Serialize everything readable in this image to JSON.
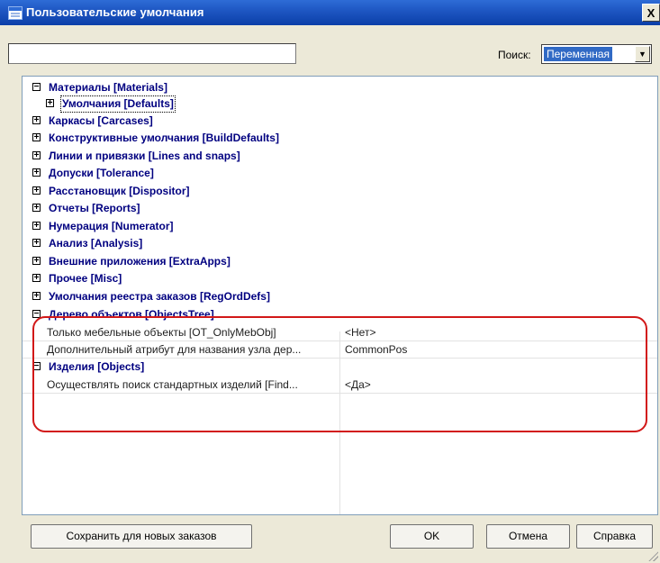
{
  "window": {
    "title": "Пользовательские умолчания",
    "close_glyph": "X"
  },
  "toolbar": {
    "filter_value": "",
    "search_label": "Поиск:",
    "search_mode": "Переменная"
  },
  "tree": {
    "sections": [
      {
        "label": "Материалы [Materials]",
        "state": "expanded",
        "level": 0
      },
      {
        "label": "Умолчания [Defaults]",
        "state": "collapsed",
        "level": 1
      },
      {
        "label": "Каркасы [Carcases]",
        "state": "collapsed",
        "level": 0
      },
      {
        "label": "Конструктивные умолчания [BuildDefaults]",
        "state": "collapsed",
        "level": 0
      },
      {
        "label": "Линии и привязки [Lines and snaps]",
        "state": "collapsed",
        "level": 0
      },
      {
        "label": "Допуски [Tolerance]",
        "state": "collapsed",
        "level": 0
      },
      {
        "label": "Расстановщик [Dispositor]",
        "state": "collapsed",
        "level": 0
      },
      {
        "label": "Отчеты [Reports]",
        "state": "collapsed",
        "level": 0
      },
      {
        "label": "Нумерация [Numerator]",
        "state": "collapsed",
        "level": 0
      },
      {
        "label": "Анализ [Analysis]",
        "state": "collapsed",
        "level": 0
      },
      {
        "label": "Внешние приложения [ExtraApps]",
        "state": "collapsed",
        "level": 0
      },
      {
        "label": "Прочее [Misc]",
        "state": "collapsed",
        "level": 0
      },
      {
        "label": "Умолчания реестра заказов [RegOrdDefs]",
        "state": "collapsed",
        "level": 0
      },
      {
        "label": "Дерево объектов [ObjectsTree]",
        "state": "expanded",
        "level": 0
      }
    ],
    "objects_tree_props": [
      {
        "name": "Только мебельные объекты [OT_OnlyMebObj]",
        "value": "<Нет>"
      },
      {
        "name": "Дополнительный атрибут для названия узла дер...",
        "value": "CommonPos"
      }
    ],
    "objects_section": {
      "label": "Изделия [Objects]",
      "state": "expanded"
    },
    "objects_props": [
      {
        "name": "Осуществлять поиск стандартных изделий [Find...",
        "value": "<Да>"
      }
    ]
  },
  "buttons": {
    "save_new": "Сохранить для новых заказов",
    "ok": "OK",
    "cancel": "Отмена",
    "help": "Справка"
  },
  "glyphs": {
    "expanded": "−",
    "collapsed": "+",
    "dropdown": "▼"
  },
  "colors": {
    "title_bar": "#1d55c1",
    "section_text": "#000080",
    "highlight": "#d21818"
  }
}
